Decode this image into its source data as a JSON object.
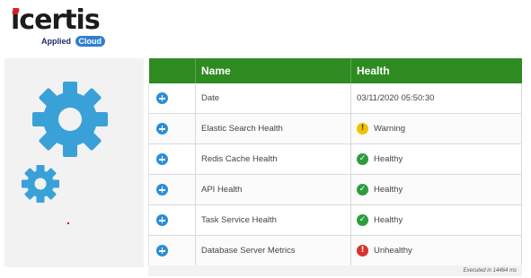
{
  "logo": {
    "brand": "icertis",
    "sub": "Applied",
    "cloud": "Cloud"
  },
  "table": {
    "headers": {
      "name": "Name",
      "health": "Health"
    },
    "rows": [
      {
        "name": "Date",
        "health": "03/11/2020 05:50:30",
        "status": "none"
      },
      {
        "name": "Elastic Search Health",
        "health": "Warning",
        "status": "warning-icon"
      },
      {
        "name": "Redis Cache Health",
        "health": "Healthy",
        "status": "check-icon"
      },
      {
        "name": "API Health",
        "health": "Healthy",
        "status": "check-icon"
      },
      {
        "name": "Task Service Health",
        "health": "Healthy",
        "status": "check-icon"
      },
      {
        "name": "Database Server Metrics",
        "health": "Unhealthy",
        "status": "error-icon"
      }
    ]
  },
  "footer": {
    "executed": "Executed in 14464 ms"
  },
  "colors": {
    "header_green": "#2e8b22",
    "gear_blue": "#3aa0d8",
    "expand_blue": "#2b8ed6"
  }
}
